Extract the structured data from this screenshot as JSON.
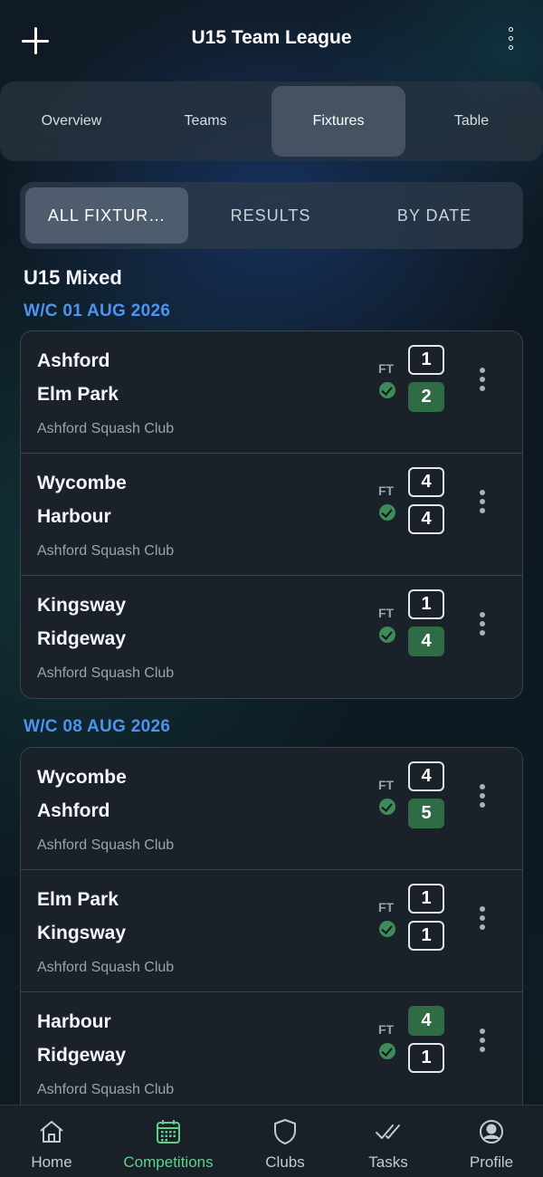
{
  "header": {
    "title": "U15 Team League"
  },
  "tabs": [
    {
      "label": "Overview",
      "active": false
    },
    {
      "label": "Teams",
      "active": false
    },
    {
      "label": "Fixtures",
      "active": true
    },
    {
      "label": "Table",
      "active": false
    }
  ],
  "segments": [
    {
      "label": "ALL FIXTUR…",
      "active": true
    },
    {
      "label": "RESULTS",
      "active": false
    },
    {
      "label": "BY DATE",
      "active": false
    }
  ],
  "section_title": "U15 Mixed",
  "weeks": [
    {
      "label": "W/C 01 AUG 2026",
      "fixtures": [
        {
          "home": "Ashford",
          "away": "Elm Park",
          "venue": "Ashford Squash Club",
          "status": "FT",
          "home_score": "1",
          "away_score": "2",
          "winner": "away"
        },
        {
          "home": "Wycombe",
          "away": "Harbour",
          "venue": "Ashford Squash Club",
          "status": "FT",
          "home_score": "4",
          "away_score": "4",
          "winner": "none"
        },
        {
          "home": "Kingsway",
          "away": "Ridgeway",
          "venue": "Ashford Squash Club",
          "status": "FT",
          "home_score": "1",
          "away_score": "4",
          "winner": "away"
        }
      ]
    },
    {
      "label": "W/C 08 AUG 2026",
      "fixtures": [
        {
          "home": "Wycombe",
          "away": "Ashford",
          "venue": "Ashford Squash Club",
          "status": "FT",
          "home_score": "4",
          "away_score": "5",
          "winner": "away"
        },
        {
          "home": "Elm Park",
          "away": "Kingsway",
          "venue": "Ashford Squash Club",
          "status": "FT",
          "home_score": "1",
          "away_score": "1",
          "winner": "none"
        },
        {
          "home": "Harbour",
          "away": "Ridgeway",
          "venue": "Ashford Squash Club",
          "status": "FT",
          "home_score": "4",
          "away_score": "1",
          "winner": "home"
        }
      ]
    }
  ],
  "bottom_nav": [
    {
      "label": "Home",
      "icon": "home-icon",
      "active": false
    },
    {
      "label": "Competitions",
      "icon": "calendar-icon",
      "active": true
    },
    {
      "label": "Clubs",
      "icon": "shield-icon",
      "active": false
    },
    {
      "label": "Tasks",
      "icon": "double-check-icon",
      "active": false
    },
    {
      "label": "Profile",
      "icon": "profile-icon",
      "active": false
    }
  ],
  "colors": {
    "accent_blue": "#4f93f0",
    "win_green": "#2f6b45",
    "nav_active": "#5fd08a"
  }
}
